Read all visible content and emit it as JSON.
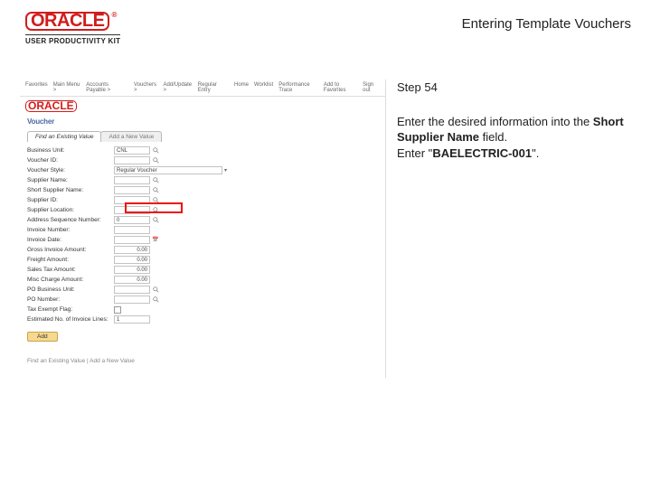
{
  "header": {
    "oracle_text": "ORACLE",
    "tm": "®",
    "subheading": "USER PRODUCTIVITY KIT",
    "page_title": "Entering Template Vouchers"
  },
  "screenshot": {
    "nav_left": [
      "Favorites",
      "Main Menu >",
      "Accounts Payable >",
      "Vouchers >",
      "Add/Update >",
      "Regular Entry"
    ],
    "nav_right": [
      "Home",
      "Worklist",
      "Performance Trace",
      "Add to Favorites",
      "Sign out"
    ],
    "brand": "ORACLE",
    "section_title": "Voucher",
    "tabs": {
      "active": "Find an Existing Value",
      "inactive": "Add a New Value"
    },
    "fields": [
      {
        "label": "Business Unit:",
        "value": "CNL",
        "mag": true
      },
      {
        "label": "Voucher ID:",
        "value": "",
        "mag": true,
        "w": "w40"
      },
      {
        "label": "Voucher Style:",
        "value": "Regular Voucher",
        "w": "w120",
        "dropdown": true
      },
      {
        "label": "Supplier Name:",
        "value": "",
        "mag": true
      },
      {
        "label": "Short Supplier Name:",
        "value": "",
        "mag": true,
        "highlight": true
      },
      {
        "label": "Supplier ID:",
        "value": "",
        "mag": true
      },
      {
        "label": "Supplier Location:",
        "value": "",
        "mag": true
      },
      {
        "label": "Address Sequence Number:",
        "value": "0",
        "mag": true,
        "w": "w30"
      },
      {
        "label": "Invoice Number:",
        "value": ""
      },
      {
        "label": "Invoice Date:",
        "value": "",
        "cal": true
      },
      {
        "label": "Gross Invoice Amount:",
        "value": "0.00",
        "w": "w40",
        "ar": true
      },
      {
        "label": "Freight Amount:",
        "value": "0.00",
        "w": "w40",
        "ar": true
      },
      {
        "label": "Sales Tax Amount:",
        "value": "0.00",
        "w": "w40",
        "ar": true
      },
      {
        "label": "Misc Charge Amount:",
        "value": "0.00",
        "w": "w40",
        "ar": true
      },
      {
        "label": "PO Business Unit:",
        "value": "",
        "mag": true
      },
      {
        "label": "PO Number:",
        "value": "",
        "mag": true
      },
      {
        "label": "Tax Exempt Flag:",
        "value": "",
        "checkbox": true
      },
      {
        "label": "Estimated No. of Invoice Lines:",
        "value": "1",
        "w": "w30"
      }
    ],
    "add_button": "Add",
    "footer": "Find an Existing Value | Add a New Value"
  },
  "instructions": {
    "step_label": "Step 54",
    "line1": "Enter the desired information into the ",
    "bold_field": "Short Supplier Name",
    "line1_tail": " field.",
    "line2_lead": "Enter \"",
    "value": "BAELECTRIC-001",
    "line2_tail": "\"."
  }
}
